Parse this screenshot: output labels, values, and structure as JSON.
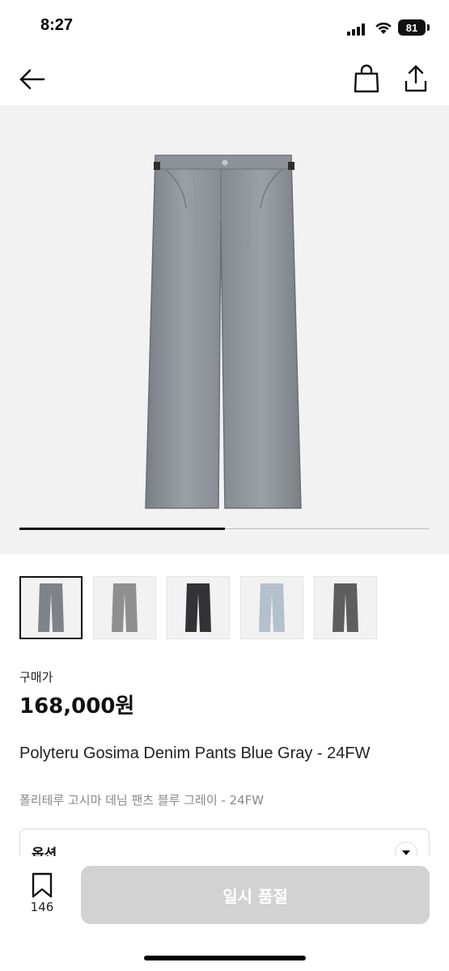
{
  "status_bar": {
    "time": "8:27",
    "battery": "81"
  },
  "product": {
    "price_label": "구매가",
    "price": "168,000원",
    "title_en": "Polyteru Gosima Denim Pants Blue Gray - 24FW",
    "title_ko": "폴리테루 고시마 데님 팬츠 블루 그레이 - 24FW",
    "image_progress": 0.5,
    "thumbnails": [
      {
        "color": "#7d8389",
        "selected": true
      },
      {
        "color": "#8f8f8f",
        "selected": false
      },
      {
        "color": "#333335",
        "selected": false
      },
      {
        "color": "#b4c0cb",
        "selected": false
      },
      {
        "color": "#5e5e5e",
        "selected": false
      }
    ]
  },
  "option": {
    "label": "옵션"
  },
  "bottom_bar": {
    "wish_count": "146",
    "buy_label": "일시 품절"
  },
  "icons": [
    "back-arrow-icon",
    "shopping-bag-icon",
    "share-icon",
    "bookmark-icon",
    "chevron-down-icon",
    "signal-icon",
    "wifi-icon",
    "battery-icon"
  ]
}
